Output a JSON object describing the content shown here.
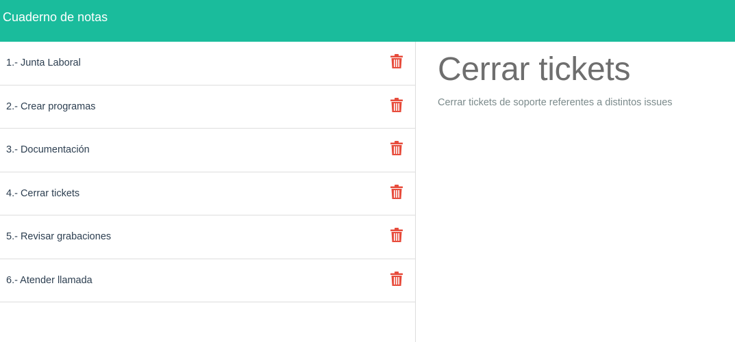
{
  "app": {
    "title": "Cuaderno de notas",
    "accent_color": "#1abc9c",
    "delete_color": "#e74c3c"
  },
  "notes": [
    {
      "label": "1.- Junta Laboral",
      "delete_icon": "trash-icon"
    },
    {
      "label": "2.- Crear programas",
      "delete_icon": "trash-icon"
    },
    {
      "label": "3.- Documentación",
      "delete_icon": "trash-icon"
    },
    {
      "label": "4.- Cerrar tickets",
      "delete_icon": "trash-icon"
    },
    {
      "label": "5.- Revisar grabaciones",
      "delete_icon": "trash-icon"
    },
    {
      "label": "6.- Atender llamada",
      "delete_icon": "trash-icon"
    }
  ],
  "detail": {
    "title": "Cerrar tickets",
    "description": "Cerrar tickets de soporte referentes a distintos issues"
  }
}
